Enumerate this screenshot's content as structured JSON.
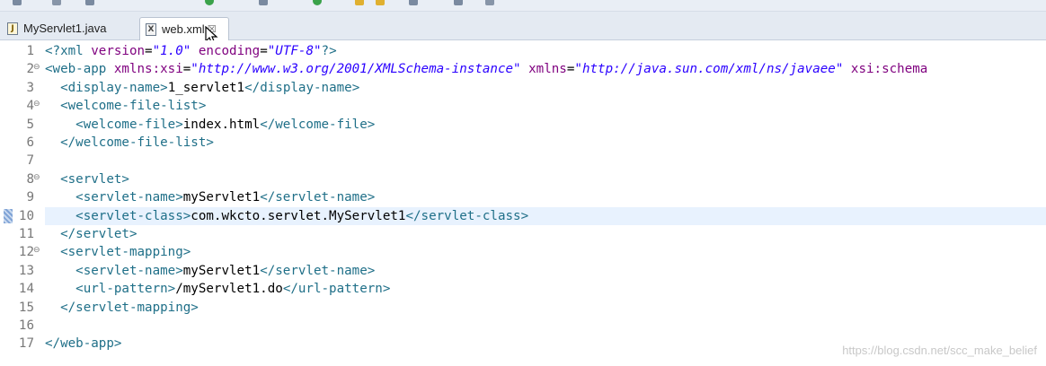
{
  "tabs": [
    {
      "label": "MyServlet1.java",
      "icon": "java-file-icon",
      "active": false
    },
    {
      "label": "web.xml",
      "icon": "xml-file-icon",
      "active": true
    }
  ],
  "editor": {
    "current_line": 10,
    "lines": [
      {
        "n": "1",
        "fold": "",
        "code": [
          {
            "t": "tag",
            "v": "<?xml "
          },
          {
            "t": "attr",
            "v": "version"
          },
          {
            "t": "txt",
            "v": "="
          },
          {
            "t": "val",
            "v": "\"1.0\""
          },
          {
            "t": "txt",
            "v": " "
          },
          {
            "t": "attr",
            "v": "encoding"
          },
          {
            "t": "txt",
            "v": "="
          },
          {
            "t": "val",
            "v": "\"UTF-8\""
          },
          {
            "t": "tag",
            "v": "?>"
          }
        ]
      },
      {
        "n": "2",
        "fold": "⊖",
        "code": [
          {
            "t": "tag",
            "v": "<web-app "
          },
          {
            "t": "attr",
            "v": "xmlns:xsi"
          },
          {
            "t": "txt",
            "v": "="
          },
          {
            "t": "val",
            "v": "\"http://www.w3.org/2001/XMLSchema-instance\""
          },
          {
            "t": "txt",
            "v": " "
          },
          {
            "t": "attr",
            "v": "xmlns"
          },
          {
            "t": "txt",
            "v": "="
          },
          {
            "t": "val",
            "v": "\"http://java.sun.com/xml/ns/javaee\""
          },
          {
            "t": "txt",
            "v": " "
          },
          {
            "t": "attr",
            "v": "xsi:schema"
          }
        ]
      },
      {
        "n": "3",
        "fold": "",
        "code": [
          {
            "t": "txt",
            "v": "  "
          },
          {
            "t": "tag",
            "v": "<display-name>"
          },
          {
            "t": "txt",
            "v": "1_servlet1"
          },
          {
            "t": "tag",
            "v": "</display-name>"
          }
        ]
      },
      {
        "n": "4",
        "fold": "⊖",
        "code": [
          {
            "t": "txt",
            "v": "  "
          },
          {
            "t": "tag",
            "v": "<welcome-file-list>"
          }
        ]
      },
      {
        "n": "5",
        "fold": "",
        "code": [
          {
            "t": "txt",
            "v": "    "
          },
          {
            "t": "tag",
            "v": "<welcome-file>"
          },
          {
            "t": "txt",
            "v": "index.html"
          },
          {
            "t": "tag",
            "v": "</welcome-file>"
          }
        ]
      },
      {
        "n": "6",
        "fold": "",
        "code": [
          {
            "t": "txt",
            "v": "  "
          },
          {
            "t": "tag",
            "v": "</welcome-file-list>"
          }
        ]
      },
      {
        "n": "7",
        "fold": "",
        "code": []
      },
      {
        "n": "8",
        "fold": "⊖",
        "code": [
          {
            "t": "txt",
            "v": "  "
          },
          {
            "t": "tag",
            "v": "<servlet>"
          }
        ]
      },
      {
        "n": "9",
        "fold": "",
        "code": [
          {
            "t": "txt",
            "v": "    "
          },
          {
            "t": "tag",
            "v": "<servlet-name>"
          },
          {
            "t": "txt",
            "v": "myServlet1"
          },
          {
            "t": "tag",
            "v": "</servlet-name>"
          }
        ]
      },
      {
        "n": "10",
        "fold": "",
        "code": [
          {
            "t": "txt",
            "v": "    "
          },
          {
            "t": "tag",
            "v": "<servlet-class>"
          },
          {
            "t": "txt",
            "v": "com.wkcto.servlet.MyServlet1"
          },
          {
            "t": "tag",
            "v": "</servlet-class>"
          }
        ]
      },
      {
        "n": "11",
        "fold": "",
        "code": [
          {
            "t": "txt",
            "v": "  "
          },
          {
            "t": "tag",
            "v": "</servlet>"
          }
        ]
      },
      {
        "n": "12",
        "fold": "⊖",
        "code": [
          {
            "t": "txt",
            "v": "  "
          },
          {
            "t": "tag",
            "v": "<servlet-mapping>"
          }
        ]
      },
      {
        "n": "13",
        "fold": "",
        "code": [
          {
            "t": "txt",
            "v": "    "
          },
          {
            "t": "tag",
            "v": "<servlet-name>"
          },
          {
            "t": "txt",
            "v": "myServlet1"
          },
          {
            "t": "tag",
            "v": "</servlet-name>"
          }
        ]
      },
      {
        "n": "14",
        "fold": "",
        "code": [
          {
            "t": "txt",
            "v": "    "
          },
          {
            "t": "tag",
            "v": "<url-pattern>"
          },
          {
            "t": "txt",
            "v": "/myServlet1.do"
          },
          {
            "t": "tag",
            "v": "</url-pattern>"
          }
        ]
      },
      {
        "n": "15",
        "fold": "",
        "code": [
          {
            "t": "txt",
            "v": "  "
          },
          {
            "t": "tag",
            "v": "</servlet-mapping>"
          }
        ]
      },
      {
        "n": "16",
        "fold": "",
        "code": []
      },
      {
        "n": "17",
        "fold": "",
        "code": [
          {
            "t": "tag",
            "v": "</web-app>"
          }
        ]
      }
    ]
  },
  "watermark": "https://blog.csdn.net/scc_make_belief",
  "colors": {
    "tag": "#1f6f88",
    "attribute": "#7f007f",
    "value": "#2a00ff",
    "text": "#000000",
    "current_line": "#e8f2fe"
  }
}
